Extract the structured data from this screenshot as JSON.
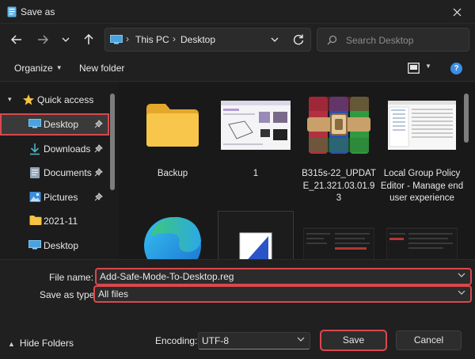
{
  "window": {
    "title": "Save as"
  },
  "address": {
    "crumbs": [
      "This PC",
      "Desktop"
    ]
  },
  "search": {
    "placeholder": "Search Desktop"
  },
  "toolbar": {
    "organize": "Organize",
    "new_folder": "New folder"
  },
  "sidebar": {
    "items": [
      {
        "label": "Quick access",
        "icon": "star-icon"
      },
      {
        "label": "Desktop",
        "icon": "desktop-icon",
        "pinned": true
      },
      {
        "label": "Downloads",
        "icon": "download-icon",
        "pinned": true
      },
      {
        "label": "Documents",
        "icon": "documents-icon",
        "pinned": true
      },
      {
        "label": "Pictures",
        "icon": "pictures-icon",
        "pinned": true
      },
      {
        "label": "2021-11",
        "icon": "folder-icon"
      },
      {
        "label": "Desktop",
        "icon": "desktop-icon"
      }
    ]
  },
  "files": [
    {
      "name": "Backup",
      "type": "folder"
    },
    {
      "name": "1",
      "type": "image"
    },
    {
      "name": "B315s-22_UPDATE_21.321.03.01.93",
      "type": "archive"
    },
    {
      "name": "Local Group Policy Editor - Manage end user experience",
      "type": "image"
    },
    {
      "name": "",
      "type": "edge"
    },
    {
      "name": "",
      "type": "app"
    },
    {
      "name": "",
      "type": "image"
    },
    {
      "name": "",
      "type": "image"
    }
  ],
  "form": {
    "file_name_label": "File name:",
    "file_name_value": "Add-Safe-Mode-To-Desktop.reg",
    "save_type_label": "Save as type:",
    "save_type_value": "All files",
    "encoding_label": "Encoding:",
    "encoding_value": "UTF-8"
  },
  "buttons": {
    "hide_folders": "Hide Folders",
    "save": "Save",
    "cancel": "Cancel"
  },
  "colors": {
    "highlight": "#d9484d",
    "accent": "#3a8ee6",
    "folder": "#f5c242",
    "background": "#202020"
  }
}
